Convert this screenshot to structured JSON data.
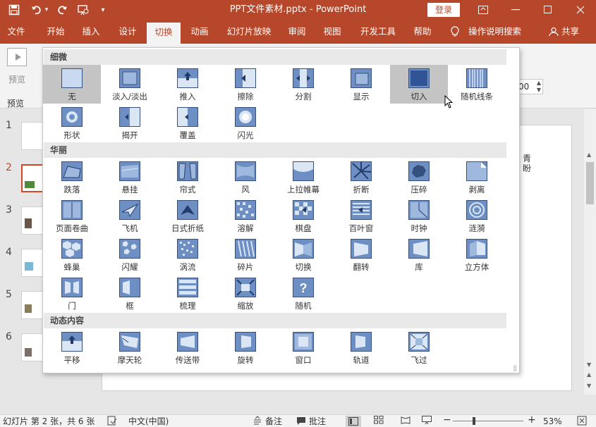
{
  "titlebar": {
    "title": "PPT文件素材.pptx  -  PowerPoint",
    "login_label": "登录",
    "save_icon": "save-icon",
    "undo_icon": "undo-icon",
    "redo_icon": "redo-icon",
    "present_icon": "present-from-start-icon",
    "customize_icon": "customize-toolbar-icon"
  },
  "tabs": [
    {
      "label": "文件"
    },
    {
      "label": "开始"
    },
    {
      "label": "插入"
    },
    {
      "label": "设计"
    },
    {
      "label": "切换"
    },
    {
      "label": "动画"
    },
    {
      "label": "幻灯片放映"
    },
    {
      "label": "审阅"
    },
    {
      "label": "视图"
    },
    {
      "label": "开发工具"
    },
    {
      "label": "帮助"
    }
  ],
  "tell_me": "操作说明搜索",
  "share": "共享",
  "ribbon": {
    "preview_label": "预览",
    "preview_group": "预览",
    "duration_value": "00"
  },
  "slides": [
    {
      "num": "1"
    },
    {
      "num": "2"
    },
    {
      "num": "3"
    },
    {
      "num": "4"
    },
    {
      "num": "5"
    },
    {
      "num": "6"
    }
  ],
  "slide_text": "青盼",
  "gallery": {
    "sections": [
      {
        "title": "细微",
        "items": [
          {
            "label": "无",
            "icon": "none-transition-icon"
          },
          {
            "label": "淡入/淡出",
            "icon": "fade-icon"
          },
          {
            "label": "推入",
            "icon": "push-icon"
          },
          {
            "label": "擦除",
            "icon": "wipe-icon"
          },
          {
            "label": "分割",
            "icon": "split-icon"
          },
          {
            "label": "显示",
            "icon": "reveal-icon"
          },
          {
            "label": "切入",
            "icon": "cut-icon"
          },
          {
            "label": "随机线条",
            "icon": "random-bars-icon"
          },
          {
            "label": "形状",
            "icon": "shape-icon"
          },
          {
            "label": "揭开",
            "icon": "uncover-icon"
          },
          {
            "label": "覆盖",
            "icon": "cover-icon"
          },
          {
            "label": "闪光",
            "icon": "flash-icon"
          }
        ]
      },
      {
        "title": "华丽",
        "items": [
          {
            "label": "跌落",
            "icon": "fall-over-icon"
          },
          {
            "label": "悬挂",
            "icon": "drape-icon"
          },
          {
            "label": "帘式",
            "icon": "curtains-icon"
          },
          {
            "label": "风",
            "icon": "wind-icon"
          },
          {
            "label": "上拉帷幕",
            "icon": "prestige-icon"
          },
          {
            "label": "折断",
            "icon": "fracture-icon"
          },
          {
            "label": "压碎",
            "icon": "crush-icon"
          },
          {
            "label": "剥离",
            "icon": "peel-off-icon"
          },
          {
            "label": "页面卷曲",
            "icon": "page-curl-icon"
          },
          {
            "label": "飞机",
            "icon": "airplane-icon"
          },
          {
            "label": "日式折纸",
            "icon": "origami-icon"
          },
          {
            "label": "溶解",
            "icon": "dissolve-icon"
          },
          {
            "label": "棋盘",
            "icon": "checkerboard-icon"
          },
          {
            "label": "百叶窗",
            "icon": "blinds-icon"
          },
          {
            "label": "时钟",
            "icon": "clock-icon"
          },
          {
            "label": "涟漪",
            "icon": "ripple-icon"
          },
          {
            "label": "蜂巢",
            "icon": "honeycomb-icon"
          },
          {
            "label": "闪耀",
            "icon": "glitter-icon"
          },
          {
            "label": "涡流",
            "icon": "vortex-icon"
          },
          {
            "label": "碎片",
            "icon": "shred-icon"
          },
          {
            "label": "切换",
            "icon": "switch-icon"
          },
          {
            "label": "翻转",
            "icon": "flip-icon"
          },
          {
            "label": "库",
            "icon": "gallery-icon"
          },
          {
            "label": "立方体",
            "icon": "cube-icon"
          },
          {
            "label": "门",
            "icon": "doors-icon"
          },
          {
            "label": "框",
            "icon": "box-icon"
          },
          {
            "label": "梳理",
            "icon": "comb-icon"
          },
          {
            "label": "缩放",
            "icon": "zoom-icon"
          },
          {
            "label": "随机",
            "icon": "random-icon"
          }
        ]
      },
      {
        "title": "动态内容",
        "items": [
          {
            "label": "平移",
            "icon": "pan-icon"
          },
          {
            "label": "摩天轮",
            "icon": "ferris-wheel-icon"
          },
          {
            "label": "传送带",
            "icon": "conveyor-icon"
          },
          {
            "label": "旋转",
            "icon": "rotate-icon"
          },
          {
            "label": "窗口",
            "icon": "window-icon"
          },
          {
            "label": "轨道",
            "icon": "orbit-icon"
          },
          {
            "label": "飞过",
            "icon": "fly-through-icon"
          }
        ]
      }
    ]
  },
  "status": {
    "slide_info": "幻灯片 第 2 张，共 6 张",
    "language": "中文(中国)",
    "notes": "备注",
    "comments": "批注",
    "zoom": "53%"
  }
}
